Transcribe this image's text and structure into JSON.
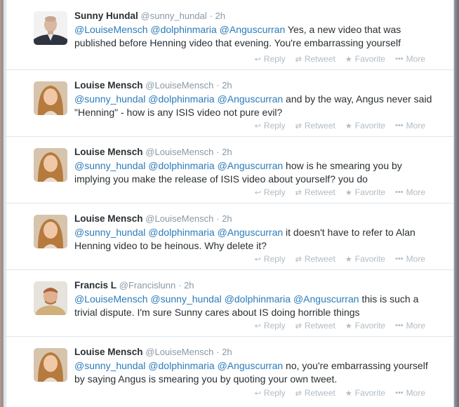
{
  "actions": {
    "reply_label": "Reply",
    "retweet_label": "Retweet",
    "favorite_label": "Favorite",
    "more_label": "More"
  },
  "tweets": [
    {
      "name": "Sunny Hundal",
      "handle": "@sunny_hundal",
      "time": "2h",
      "mentions": [
        "@LouiseMensch",
        "@dolphinmaria",
        "@Anguscurran"
      ],
      "text": "Yes, a new video that was published before Henning video that evening. You're embarrassing yourself",
      "avatar": "sunny-avatar"
    },
    {
      "name": "Louise Mensch",
      "handle": "@LouiseMensch",
      "time": "2h",
      "mentions": [
        "@sunny_hundal",
        "@dolphinmaria",
        "@Anguscurran"
      ],
      "text": "and by the way, Angus never said \"Henning\" - how is any ISIS video not pure evil?",
      "avatar": "louise-avatar"
    },
    {
      "name": "Louise Mensch",
      "handle": "@LouiseMensch",
      "time": "2h",
      "mentions": [
        "@sunny_hundal",
        "@dolphinmaria",
        "@Anguscurran"
      ],
      "text": "how is he smearing you by implying you make the release of ISIS video about yourself? you do",
      "avatar": "louise-avatar"
    },
    {
      "name": "Louise Mensch",
      "handle": "@LouiseMensch",
      "time": "2h",
      "mentions": [
        "@sunny_hundal",
        "@dolphinmaria",
        "@Anguscurran"
      ],
      "text": "it doesn't have to refer to Alan Henning video to be heinous. Why delete it?",
      "avatar": "louise-avatar"
    },
    {
      "name": "Francis L",
      "handle": "@Francislunn",
      "time": "2h",
      "mentions": [
        "@LouiseMensch",
        "@sunny_hundal",
        "@dolphinmaria",
        "@Anguscurran"
      ],
      "text": "this is such a trivial dispute. I'm sure Sunny cares about IS doing horrible things",
      "avatar": "francis-avatar"
    },
    {
      "name": "Louise Mensch",
      "handle": "@LouiseMensch",
      "time": "2h",
      "mentions": [
        "@sunny_hundal",
        "@dolphinmaria",
        "@Anguscurran"
      ],
      "text": "no, you're embarrassing yourself by saying Angus is smearing you by quoting your own tweet.",
      "avatar": "louise-avatar"
    }
  ]
}
